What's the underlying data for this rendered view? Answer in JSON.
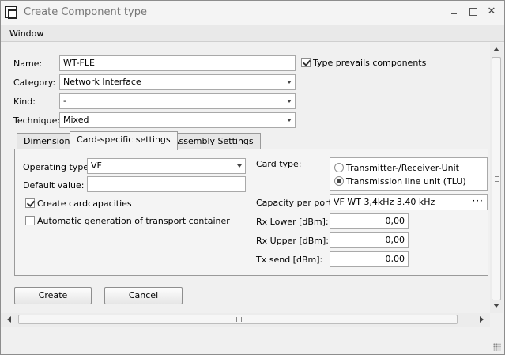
{
  "window": {
    "title": "Create Component type"
  },
  "menu": {
    "items": [
      "Window"
    ]
  },
  "form": {
    "name_label": "Name:",
    "name_value": "WT-FLE",
    "type_prevails_label": "Type prevails components",
    "type_prevails_checked": true,
    "category_label": "Category:",
    "category_value": "Network Interface",
    "kind_label": "Kind:",
    "kind_value": "-",
    "technique_label": "Technique:",
    "technique_value": "Mixed"
  },
  "tabs": [
    {
      "label": "Dimension",
      "active": false
    },
    {
      "label": "Card-specific settings",
      "active": true
    },
    {
      "label": "Assembly Settings",
      "active": false
    }
  ],
  "card": {
    "operating_type_label": "Operating type:",
    "operating_type_value": "VF",
    "default_value_label": "Default value:",
    "default_value_value": "",
    "create_cardcapacities_label": "Create cardcapacities",
    "create_cardcapacities_checked": true,
    "auto_transport_label": "Automatic generation of transport container",
    "auto_transport_checked": false,
    "card_type_label": "Card type:",
    "card_type_options": [
      "Transmitter-/Receiver-Unit",
      "Transmission line unit (TLU)"
    ],
    "card_type_selected": 1,
    "capacity_label": "Capacity per port:",
    "capacity_value": "VF WT 3,4kHz 3.40 kHz",
    "rx_lower_label": "Rx Lower [dBm]:",
    "rx_lower_value": "0,00",
    "rx_upper_label": "Rx Upper [dBm]:",
    "rx_upper_value": "0,00",
    "tx_send_label": "Tx send [dBm]:",
    "tx_send_value": "0,00"
  },
  "buttons": {
    "create": "Create",
    "cancel": "Cancel"
  },
  "icons": {
    "app": "app-logo-icon",
    "minimize": "minimize-icon",
    "maximize": "maximize-icon",
    "close": "close-icon",
    "dropdown": "chevron-down-icon",
    "ellipsis": "ellipsis-icon"
  }
}
